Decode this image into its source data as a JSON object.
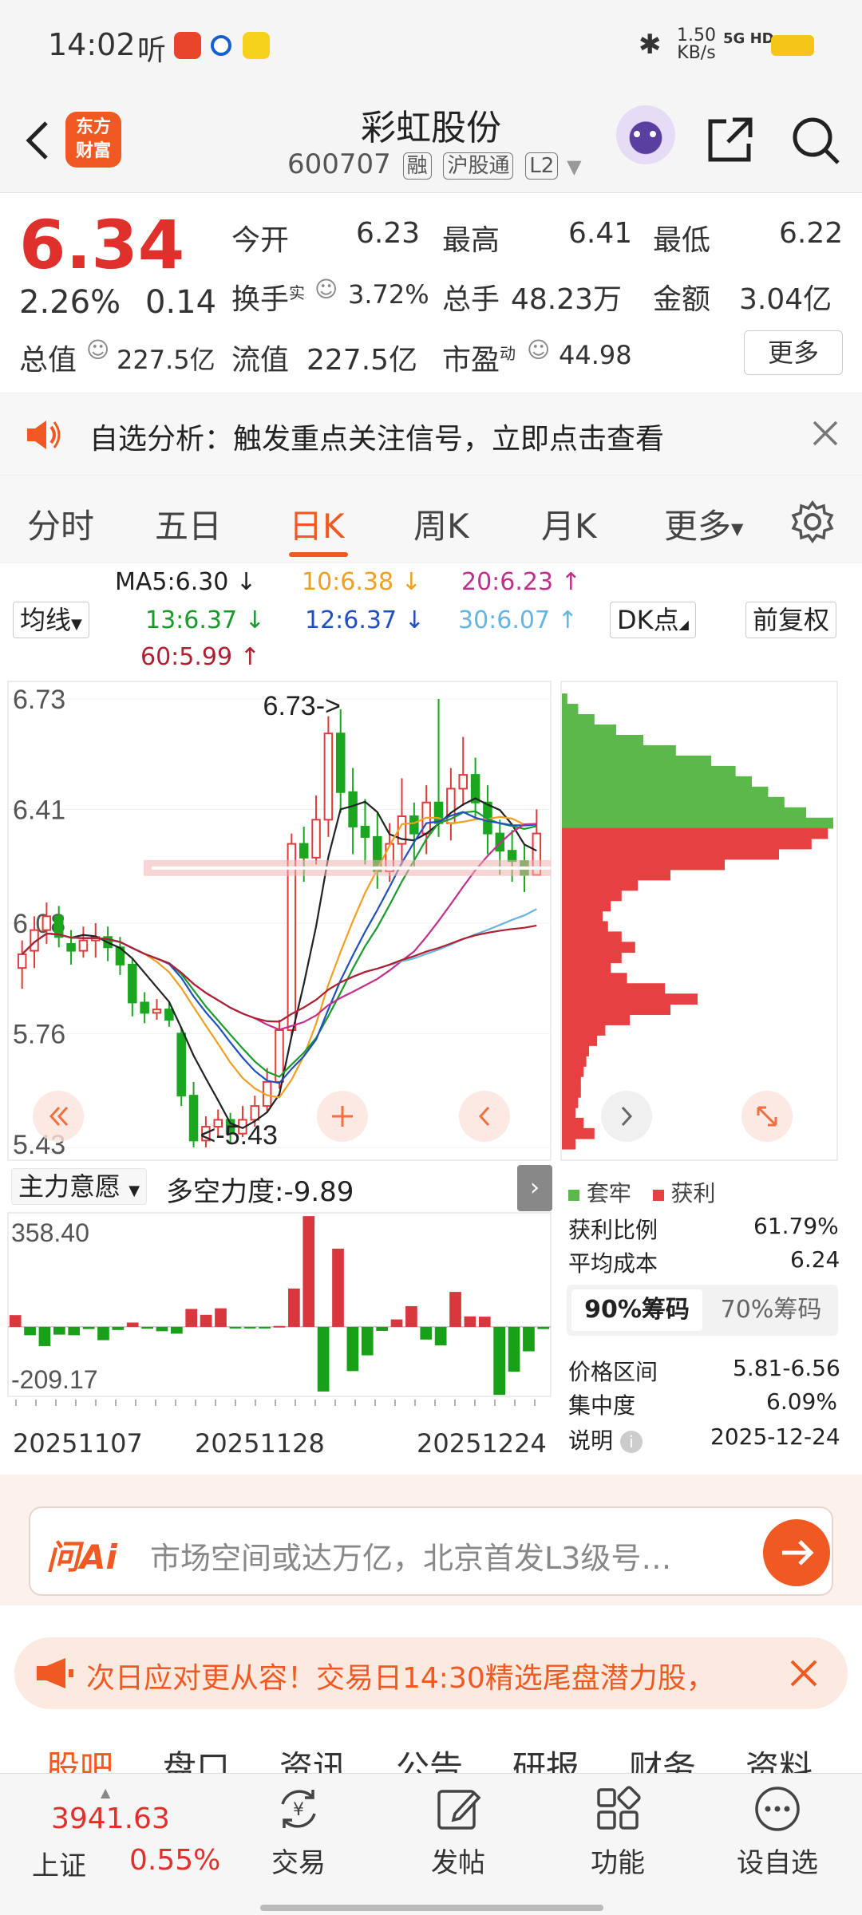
{
  "status_bar": {
    "time": "14:02",
    "ting": "听",
    "net_speed_top": "1.50",
    "net_speed_unit": "KB/s",
    "network": "5G HD"
  },
  "header": {
    "logo_line1": "东方",
    "logo_line2": "财富",
    "stock_name": "彩虹股份",
    "stock_code": "600707",
    "tags": [
      "融",
      "沪股通",
      "L2"
    ]
  },
  "quote": {
    "price": "6.34",
    "change_pct": "2.26%",
    "change": "0.14",
    "open_label": "今开",
    "open": "6.23",
    "high_label": "最高",
    "high": "6.41",
    "low_label": "最低",
    "low": "6.22",
    "turnover_label": "换手",
    "turnover_sup": "实",
    "turnover": "3.72%",
    "volume_label": "总手",
    "volume": "48.23万",
    "amount_label": "金额",
    "amount": "3.04亿",
    "total_value_label": "总值",
    "total_value": "227.5亿",
    "float_value_label": "流值",
    "float_value": "227.5亿",
    "pe_label": "市盈",
    "pe_sup": "动",
    "pe": "44.98",
    "more_label": "更多"
  },
  "notice": {
    "text": "自选分析：触发重点关注信号，立即点击查看"
  },
  "tabs": [
    {
      "label": "分时"
    },
    {
      "label": "五日"
    },
    {
      "label": "日K"
    },
    {
      "label": "周K"
    },
    {
      "label": "月K"
    },
    {
      "label": "更多"
    }
  ],
  "ma": {
    "selector_label": "均线",
    "ma5": "MA5:6.30 ↓",
    "ma10": "10:6.38 ↓",
    "ma20": "20:6.23 ↑",
    "ma13": "13:6.37 ↓",
    "ma12": "12:6.37 ↓",
    "ma30": "30:6.07 ↑",
    "ma60": "60:5.99 ↑",
    "dk_label": "DK点",
    "fq_label": "前复权",
    "colors": {
      "ma5": "#222222",
      "ma10": "#f0a020",
      "ma20": "#c0308a",
      "ma13": "#1a9a2a",
      "ma12": "#2050c0",
      "ma30": "#66b4e0",
      "ma60": "#b02030"
    }
  },
  "chart_data": {
    "type": "candlestick",
    "y_ticks": [
      "6.73",
      "6.41",
      "6.08",
      "5.76",
      "5.43"
    ],
    "ylim": [
      5.43,
      6.73
    ],
    "max_label": "6.73->",
    "min_label": "<-5.43",
    "candles": [
      [
        5.95,
        5.99,
        6.03,
        5.89
      ],
      [
        6.0,
        6.06,
        6.1,
        5.95
      ],
      [
        6.06,
        6.1,
        6.14,
        6.02
      ],
      [
        6.1,
        6.04,
        6.13,
        6.01
      ],
      [
        6.02,
        6.0,
        6.06,
        5.96
      ],
      [
        6.0,
        6.03,
        6.07,
        5.98
      ],
      [
        6.03,
        6.04,
        6.08,
        5.98
      ],
      [
        6.04,
        6.01,
        6.07,
        5.97
      ],
      [
        6.01,
        5.96,
        6.04,
        5.93
      ],
      [
        5.96,
        5.85,
        5.98,
        5.81
      ],
      [
        5.85,
        5.82,
        5.88,
        5.79
      ],
      [
        5.82,
        5.83,
        5.86,
        5.8
      ],
      [
        5.83,
        5.8,
        5.85,
        5.78
      ],
      [
        5.76,
        5.58,
        5.78,
        5.55
      ],
      [
        5.58,
        5.45,
        5.62,
        5.43
      ],
      [
        5.45,
        5.49,
        5.52,
        5.43
      ],
      [
        5.49,
        5.51,
        5.54,
        5.46
      ],
      [
        5.51,
        5.47,
        5.53,
        5.44
      ],
      [
        5.47,
        5.51,
        5.55,
        5.46
      ],
      [
        5.51,
        5.55,
        5.58,
        5.49
      ],
      [
        5.55,
        5.62,
        5.66,
        5.53
      ],
      [
        5.62,
        5.77,
        5.8,
        5.6
      ],
      [
        5.77,
        6.31,
        6.34,
        5.75
      ],
      [
        6.31,
        6.27,
        6.36,
        6.2
      ],
      [
        6.27,
        6.38,
        6.45,
        6.25
      ],
      [
        6.38,
        6.63,
        6.68,
        6.33
      ],
      [
        6.63,
        6.46,
        6.7,
        6.4
      ],
      [
        6.46,
        6.36,
        6.53,
        6.28
      ],
      [
        6.36,
        6.33,
        6.44,
        6.25
      ],
      [
        6.33,
        6.23,
        6.4,
        6.18
      ],
      [
        6.23,
        6.31,
        6.37,
        6.2
      ],
      [
        6.31,
        6.39,
        6.5,
        6.25
      ],
      [
        6.39,
        6.34,
        6.43,
        6.24
      ],
      [
        6.34,
        6.43,
        6.48,
        6.28
      ],
      [
        6.43,
        6.37,
        6.73,
        6.33
      ],
      [
        6.37,
        6.47,
        6.53,
        6.32
      ],
      [
        6.47,
        6.51,
        6.62,
        6.42
      ],
      [
        6.51,
        6.43,
        6.56,
        6.38
      ],
      [
        6.43,
        6.34,
        6.48,
        6.28
      ],
      [
        6.34,
        6.29,
        6.38,
        6.22
      ],
      [
        6.29,
        6.26,
        6.35,
        6.2
      ],
      [
        6.26,
        6.22,
        6.31,
        6.17
      ],
      [
        6.22,
        6.34,
        6.41,
        6.22
      ]
    ],
    "volume_indicator": {
      "label": "主力意愿",
      "value_label": "多空力度:-9.89",
      "y_ticks": [
        "358.40",
        "-209.17"
      ],
      "ylim": [
        -209.17,
        358.4
      ],
      "values": [
        38,
        -27,
        -62,
        -25,
        -27,
        -7,
        -43,
        -10,
        14,
        -6,
        -14,
        -22,
        58,
        39,
        60,
        -2,
        -1,
        -4,
        3,
        124,
        358,
        -209,
        253,
        -143,
        -92,
        -13,
        24,
        67,
        -41,
        -60,
        113,
        34,
        33,
        -220,
        -145,
        -79,
        -7
      ]
    },
    "x_labels": [
      "20251107",
      "20251128",
      "20251224"
    ]
  },
  "chip": {
    "legend_trapped": "套牢",
    "legend_profit": "获利",
    "profit_ratio_label": "获利比例",
    "profit_ratio": "61.79%",
    "avg_cost_label": "平均成本",
    "avg_cost": "6.24",
    "tab90": "90%筹码",
    "tab70": "70%筹码",
    "price_range_label": "价格区间",
    "price_range": "5.81-6.56",
    "concentration_label": "集中度",
    "concentration": "6.09%",
    "note_label": "说明",
    "date": "2025-12-24",
    "profile": {
      "price_levels_high_to_low": [
        6.73,
        6.7,
        6.67,
        6.64,
        6.61,
        6.58,
        6.55,
        6.52,
        6.49,
        6.46,
        6.43,
        6.4,
        6.37,
        6.34,
        6.31,
        6.28,
        6.25,
        6.22,
        6.19,
        6.16,
        6.13,
        6.1,
        6.07,
        6.04,
        6.01,
        5.98,
        5.95,
        5.92,
        5.89,
        5.86,
        5.83,
        5.8,
        5.77,
        5.74,
        5.71,
        5.68,
        5.65,
        5.62,
        5.59,
        5.56,
        5.53,
        5.5,
        5.47,
        5.44
      ],
      "weights": [
        0.02,
        0.06,
        0.12,
        0.2,
        0.3,
        0.42,
        0.55,
        0.64,
        0.7,
        0.76,
        0.82,
        0.9,
        1.0,
        0.98,
        0.92,
        0.8,
        0.6,
        0.4,
        0.28,
        0.22,
        0.18,
        0.15,
        0.17,
        0.22,
        0.27,
        0.22,
        0.18,
        0.24,
        0.38,
        0.5,
        0.4,
        0.25,
        0.16,
        0.13,
        0.1,
        0.09,
        0.08,
        0.07,
        0.07,
        0.06,
        0.05,
        0.08,
        0.12,
        0.05
      ]
    }
  },
  "ai_search": {
    "brand": "问Ai",
    "placeholder": "市场空间或达万亿，北京首发L3级号…"
  },
  "promo": {
    "text": "次日应对更从容！交易日14:30精选尾盘潜力股，"
  },
  "bottom_tabs": [
    "股吧",
    "盘口",
    "资讯",
    "公告",
    "研报",
    "财务",
    "资料"
  ],
  "bottom_bar": {
    "index_value": "3941.63",
    "index_name": "上证",
    "index_change": "0.55%",
    "items": [
      {
        "label": "交易"
      },
      {
        "label": "发帖"
      },
      {
        "label": "功能"
      },
      {
        "label": "设自选"
      }
    ]
  }
}
